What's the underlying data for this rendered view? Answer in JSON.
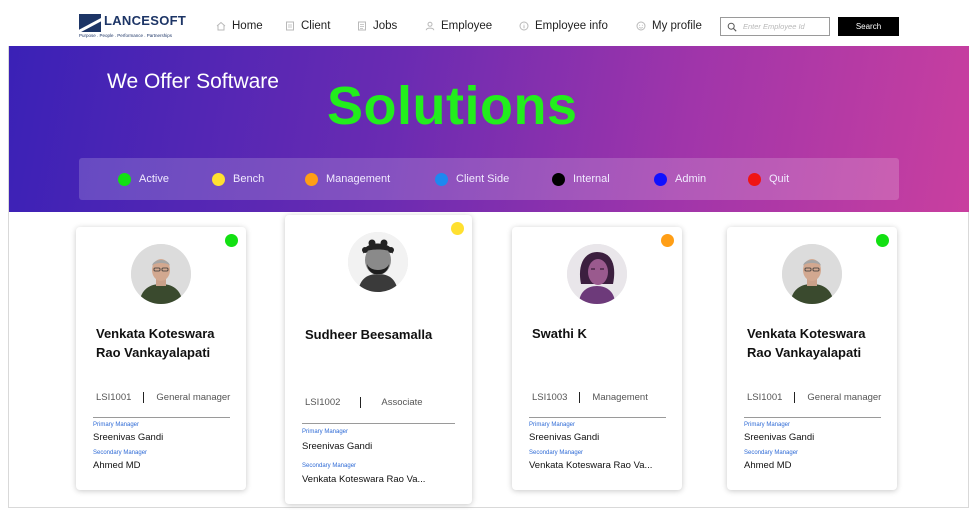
{
  "brand": {
    "name": "LANCESOFT",
    "tagline": "Purpose . People . Performance . Partnerships"
  },
  "nav": {
    "items": [
      {
        "label": "Home",
        "icon": "home-icon"
      },
      {
        "label": "Client",
        "icon": "client-icon"
      },
      {
        "label": "Jobs",
        "icon": "jobs-icon"
      },
      {
        "label": "Employee",
        "icon": "employee-icon"
      },
      {
        "label": "Employee info",
        "icon": "info-icon"
      },
      {
        "label": "My profile",
        "icon": "profile-icon"
      }
    ],
    "search_placeholder": "Enter Employee Id",
    "search_value": "",
    "search_button": "Search"
  },
  "hero": {
    "subtitle": "We Offer Software",
    "title": "Solutions",
    "title_color": "#22ee1c"
  },
  "legend": [
    {
      "label": "Active",
      "color": "#12e012"
    },
    {
      "label": "Bench",
      "color": "#ffe030"
    },
    {
      "label": "Management",
      "color": "#ff9e16"
    },
    {
      "label": "Client Side",
      "color": "#1e88f0"
    },
    {
      "label": "Internal",
      "color": "#000000"
    },
    {
      "label": "Admin",
      "color": "#1010ff"
    },
    {
      "label": "Quit",
      "color": "#f01414"
    }
  ],
  "employees": [
    {
      "name": "Venkata Koteswara Rao Vankayalapati",
      "id": "LSI1001",
      "role": "General manager",
      "status_color": "#12e012",
      "primary_manager_label": "Primary Manager",
      "primary_manager": "Sreenivas Gandi",
      "secondary_manager_label": "Secondary Manager",
      "secondary_manager": "Ahmed MD"
    },
    {
      "name": "Sudheer Beesamalla",
      "id": "LSI1002",
      "role": "Associate",
      "status_color": "#ffe030",
      "primary_manager_label": "Primary Manager",
      "primary_manager": "Sreenivas Gandi",
      "secondary_manager_label": "Secondary Manager",
      "secondary_manager": "Venkata Koteswara Rao Va..."
    },
    {
      "name": "Swathi K",
      "id": "LSI1003",
      "role": "Management",
      "status_color": "#ff9e16",
      "primary_manager_label": "Primary Manager",
      "primary_manager": "Sreenivas Gandi",
      "secondary_manager_label": "Secondary Manager",
      "secondary_manager": "Venkata Koteswara Rao Va..."
    },
    {
      "name": "Venkata Koteswara Rao Vankayalapati",
      "id": "LSI1001",
      "role": "General manager",
      "status_color": "#12e012",
      "primary_manager_label": "Primary Manager",
      "primary_manager": "Sreenivas Gandi",
      "secondary_manager_label": "Secondary Manager",
      "secondary_manager": "Ahmed MD"
    }
  ]
}
